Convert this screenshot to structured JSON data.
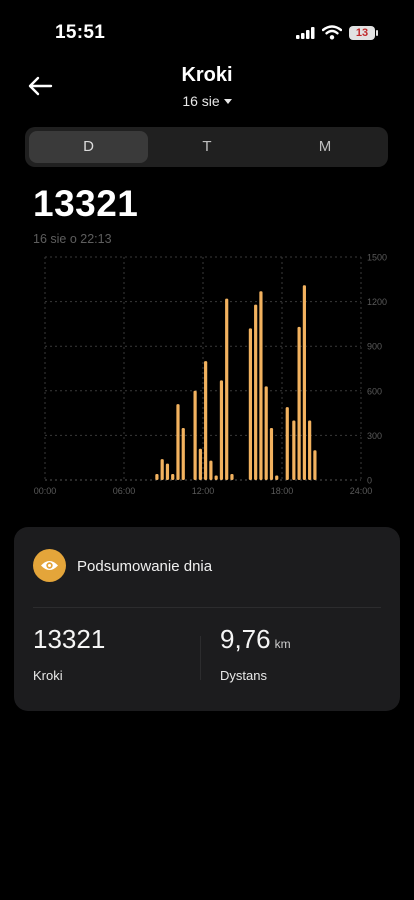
{
  "status_bar": {
    "time": "15:51",
    "battery": "13"
  },
  "header": {
    "title": "Kroki",
    "date": "16 sie"
  },
  "tabs": [
    {
      "label": "D",
      "active": true
    },
    {
      "label": "T",
      "active": false
    },
    {
      "label": "M",
      "active": false
    }
  ],
  "summary_top": {
    "value": "13321",
    "timestamp": "16 sie o 22:13"
  },
  "chart_data": {
    "type": "bar",
    "x_tick_labels": [
      "00:00",
      "06:00",
      "12:00",
      "18:00",
      "24:00"
    ],
    "y_tick_labels": [
      "0",
      "300",
      "600",
      "900",
      "1200",
      "1500"
    ],
    "xlim": [
      0,
      24
    ],
    "ylim": [
      0,
      1500
    ],
    "grid": true,
    "y_axis_position": "right",
    "bar_color": "#f2b25f",
    "x": [
      8.5,
      8.9,
      9.3,
      9.7,
      10.1,
      10.5,
      11.0,
      11.4,
      11.8,
      12.2,
      12.6,
      13.0,
      13.4,
      13.8,
      14.2,
      14.6,
      15.0,
      15.6,
      16.0,
      16.4,
      16.8,
      17.2,
      17.6,
      18.0,
      18.4,
      18.9,
      19.3,
      19.7,
      20.1,
      20.5,
      20.9,
      21.3,
      21.7
    ],
    "values": [
      40,
      140,
      110,
      40,
      510,
      350,
      0,
      600,
      210,
      800,
      130,
      30,
      670,
      1220,
      40,
      0,
      0,
      1020,
      1180,
      1270,
      630,
      350,
      30,
      0,
      490,
      400,
      1030,
      1310,
      400,
      200,
      0,
      0,
      0
    ]
  },
  "day_summary": {
    "title": "Podsumowanie dnia",
    "steps_value": "13321",
    "steps_label": "Kroki",
    "distance_value": "9,76",
    "distance_unit": "km",
    "distance_label": "Dystans"
  },
  "colors": {
    "accent": "#e4a53a",
    "bar": "#f2b25f",
    "card": "#1c1c1e"
  }
}
